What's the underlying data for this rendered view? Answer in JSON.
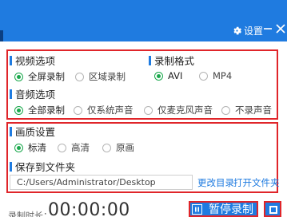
{
  "titlebar": {
    "settings_label": "设置",
    "bg_color": "#1f7be0"
  },
  "video_options": {
    "title": "视频选项",
    "options": [
      {
        "label": "全屏录制",
        "selected": true
      },
      {
        "label": "区域录制",
        "selected": false
      }
    ]
  },
  "record_format": {
    "title": "录制格式",
    "options": [
      {
        "label": "AVI",
        "selected": true
      },
      {
        "label": "MP4",
        "selected": false
      }
    ]
  },
  "audio_options": {
    "title": "音频选项",
    "options": [
      {
        "label": "全部录制",
        "selected": true
      },
      {
        "label": "仅系统声音",
        "selected": false
      },
      {
        "label": "仅麦克风声音",
        "selected": false
      },
      {
        "label": "不录声音",
        "selected": false
      }
    ]
  },
  "quality": {
    "title": "画质设置",
    "options": [
      {
        "label": "标清",
        "selected": true
      },
      {
        "label": "高清",
        "selected": false
      },
      {
        "label": "原画",
        "selected": false
      }
    ]
  },
  "save_to": {
    "title": "保存到文件夹",
    "path": "C:/Users/Administrator/Desktop",
    "change_dir_label": "更改目录",
    "open_folder_label": "打开文件夹"
  },
  "status": {
    "record_time_label": "录制时长：",
    "timer": "00:00:00",
    "pause_label": "暂停录制"
  },
  "colors": {
    "accent": "#1f7be0",
    "highlight_border": "#e0252a",
    "radio_selected": "#1aa84c",
    "link": "#1f7be0"
  }
}
